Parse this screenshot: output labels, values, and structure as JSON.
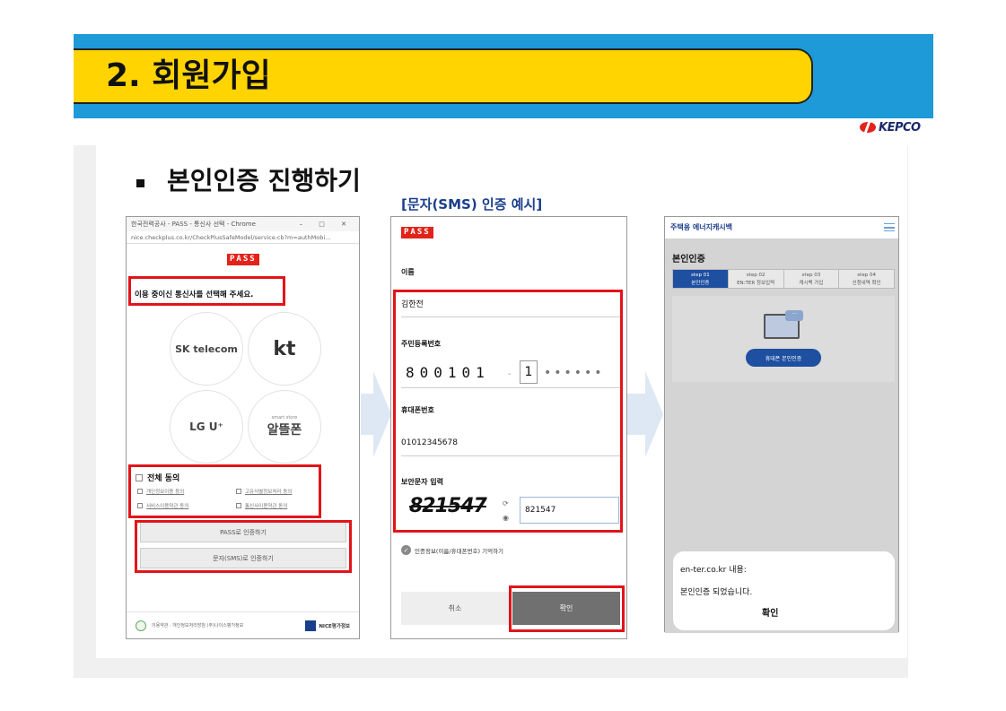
{
  "slide": {
    "title": "2. 회원가입",
    "logo": "KEPCO",
    "heading": "본인인증 진행하기",
    "sms_caption": "[문자(SMS) 인증 예시]"
  },
  "panel1": {
    "window_title": "한국전력공사 - PASS - 통신사 선택 - Chrome",
    "window_controls": "–  □  ✕",
    "url": "nice.checkplus.co.kr/CheckPlusSafeModel/service.cb?m=authMobi...",
    "pass_logo": "PASS",
    "prompt": "이용 중이신 통신사를 선택해 주세요.",
    "carriers": {
      "skt": "SK telecom",
      "kt": "kt",
      "lgu": "LG U⁺",
      "mvno": "알뜰폰",
      "mvno_sub": "smart store"
    },
    "agree_all": "전체 동의",
    "agreements": [
      "개인정보이용 동의",
      "고유식별정보처리 동의",
      "서비스이용약관 동의",
      "통신사이용약관 동의"
    ],
    "pass_button": "PASS로 인증하기",
    "sms_button": "문자(SMS)로 인증하기",
    "footer_text": "이용약관 · 개인정보처리방침 (주)나이스평가정보",
    "footer_brand": "NICE평가정보"
  },
  "panel2": {
    "pass_logo": "PASS",
    "name_label": "이름",
    "name_value": "김한전",
    "rrn_label": "주민등록번호",
    "rrn_front": "800101",
    "rrn_dash": "-",
    "rrn_back_first": "1",
    "rrn_masked": "••••••",
    "phone_label": "휴대폰번호",
    "phone_value": "01012345678",
    "security_label": "보안문자 입력",
    "captcha": "821547",
    "captcha_input": "821547",
    "remember": "인증정보(이름/휴대폰번호) 기억하기",
    "cancel": "취소",
    "confirm": "확인"
  },
  "panel3": {
    "site_name": "주택용 에너지캐시백",
    "page_title": "본인인증",
    "steps": [
      {
        "num": "step 01",
        "label": "본인인증"
      },
      {
        "num": "step 02",
        "label": "EN:TER 정보입력"
      },
      {
        "num": "step 03",
        "label": "캐시백 가입"
      },
      {
        "num": "step 04",
        "label": "신청내역 확인"
      }
    ],
    "phone_auth_button": "휴대폰 본인인증",
    "alert_title": "en-ter.co.kr 내용:",
    "alert_message": "본인인증 되었습니다.",
    "alert_ok": "확인"
  },
  "colors": {
    "band": "#1e9ad8",
    "title_fill": "#ffd400",
    "highlight": "#e2141b",
    "accent": "#1e4fa0"
  }
}
